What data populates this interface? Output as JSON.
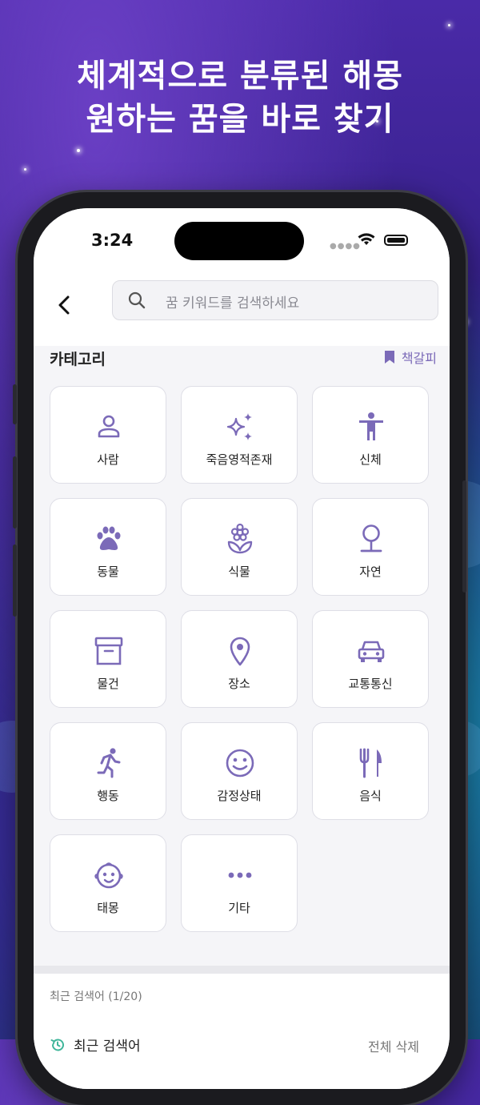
{
  "headline": {
    "line1": "체계적으로 분류된 해몽",
    "line2": "원하는 꿈을 바로 찾기"
  },
  "status": {
    "time": "3:24",
    "signal_icon": "signal-dots-icon",
    "wifi_icon": "wifi-icon",
    "battery_icon": "battery-icon"
  },
  "header": {
    "back_icon": "chevron-left-icon",
    "search_placeholder": "꿈 키워드를 검색하세요"
  },
  "category": {
    "title": "카테고리",
    "bookmark_label": "책갈피",
    "items": [
      {
        "label": "사람",
        "icon": "person-icon"
      },
      {
        "label": "죽음영적존재",
        "icon": "sparkles-icon"
      },
      {
        "label": "신체",
        "icon": "body-icon"
      },
      {
        "label": "동물",
        "icon": "paw-icon"
      },
      {
        "label": "식물",
        "icon": "flower-icon"
      },
      {
        "label": "자연",
        "icon": "tree-icon"
      },
      {
        "label": "물건",
        "icon": "box-icon"
      },
      {
        "label": "장소",
        "icon": "location-pin-icon"
      },
      {
        "label": "교통통신",
        "icon": "car-icon"
      },
      {
        "label": "행동",
        "icon": "running-icon"
      },
      {
        "label": "감정상태",
        "icon": "smile-icon"
      },
      {
        "label": "음식",
        "icon": "fork-knife-icon"
      },
      {
        "label": "태몽",
        "icon": "baby-face-icon"
      },
      {
        "label": "기타",
        "icon": "more-dots-icon"
      }
    ]
  },
  "recent": {
    "count_label": "최근 검색어 (1/20)",
    "title": "최근 검색어",
    "clear_all": "전체 삭제"
  },
  "colors": {
    "accent": "#7b6ab8",
    "screen_bg": "#f5f5f8"
  }
}
